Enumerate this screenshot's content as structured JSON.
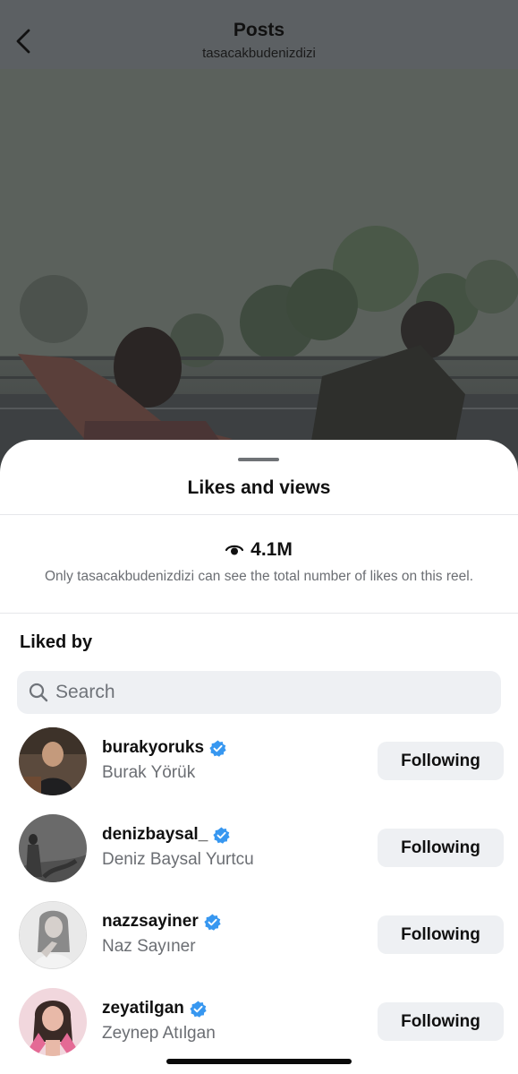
{
  "header": {
    "title": "Posts",
    "subtitle": "tasacakbudenizdizi",
    "back_icon": "chevron-left-icon"
  },
  "sheet": {
    "title": "Likes and views",
    "views_icon": "eye-icon",
    "views_count": "4.1M",
    "views_note": "Only tasacakbudenizdizi can see the total number of likes on this reel.",
    "liked_by_label": "Liked by",
    "search_placeholder": "Search",
    "search_icon": "search-icon",
    "users": [
      {
        "handle": "burakyoruks",
        "name": "Burak Yörük",
        "verified": true,
        "button_label": "Following"
      },
      {
        "handle": "denizbaysal_",
        "name": "Deniz Baysal Yurtcu",
        "verified": true,
        "button_label": "Following"
      },
      {
        "handle": "nazzsayiner",
        "name": "Naz Sayıner",
        "verified": true,
        "button_label": "Following"
      },
      {
        "handle": "zeyatilgan",
        "name": "Zeynep Atılgan",
        "verified": true,
        "button_label": "Following"
      }
    ]
  },
  "colors": {
    "verified_badge": "#3797f0",
    "button_bg": "#eef0f3",
    "secondary_text": "#6b6e73"
  }
}
